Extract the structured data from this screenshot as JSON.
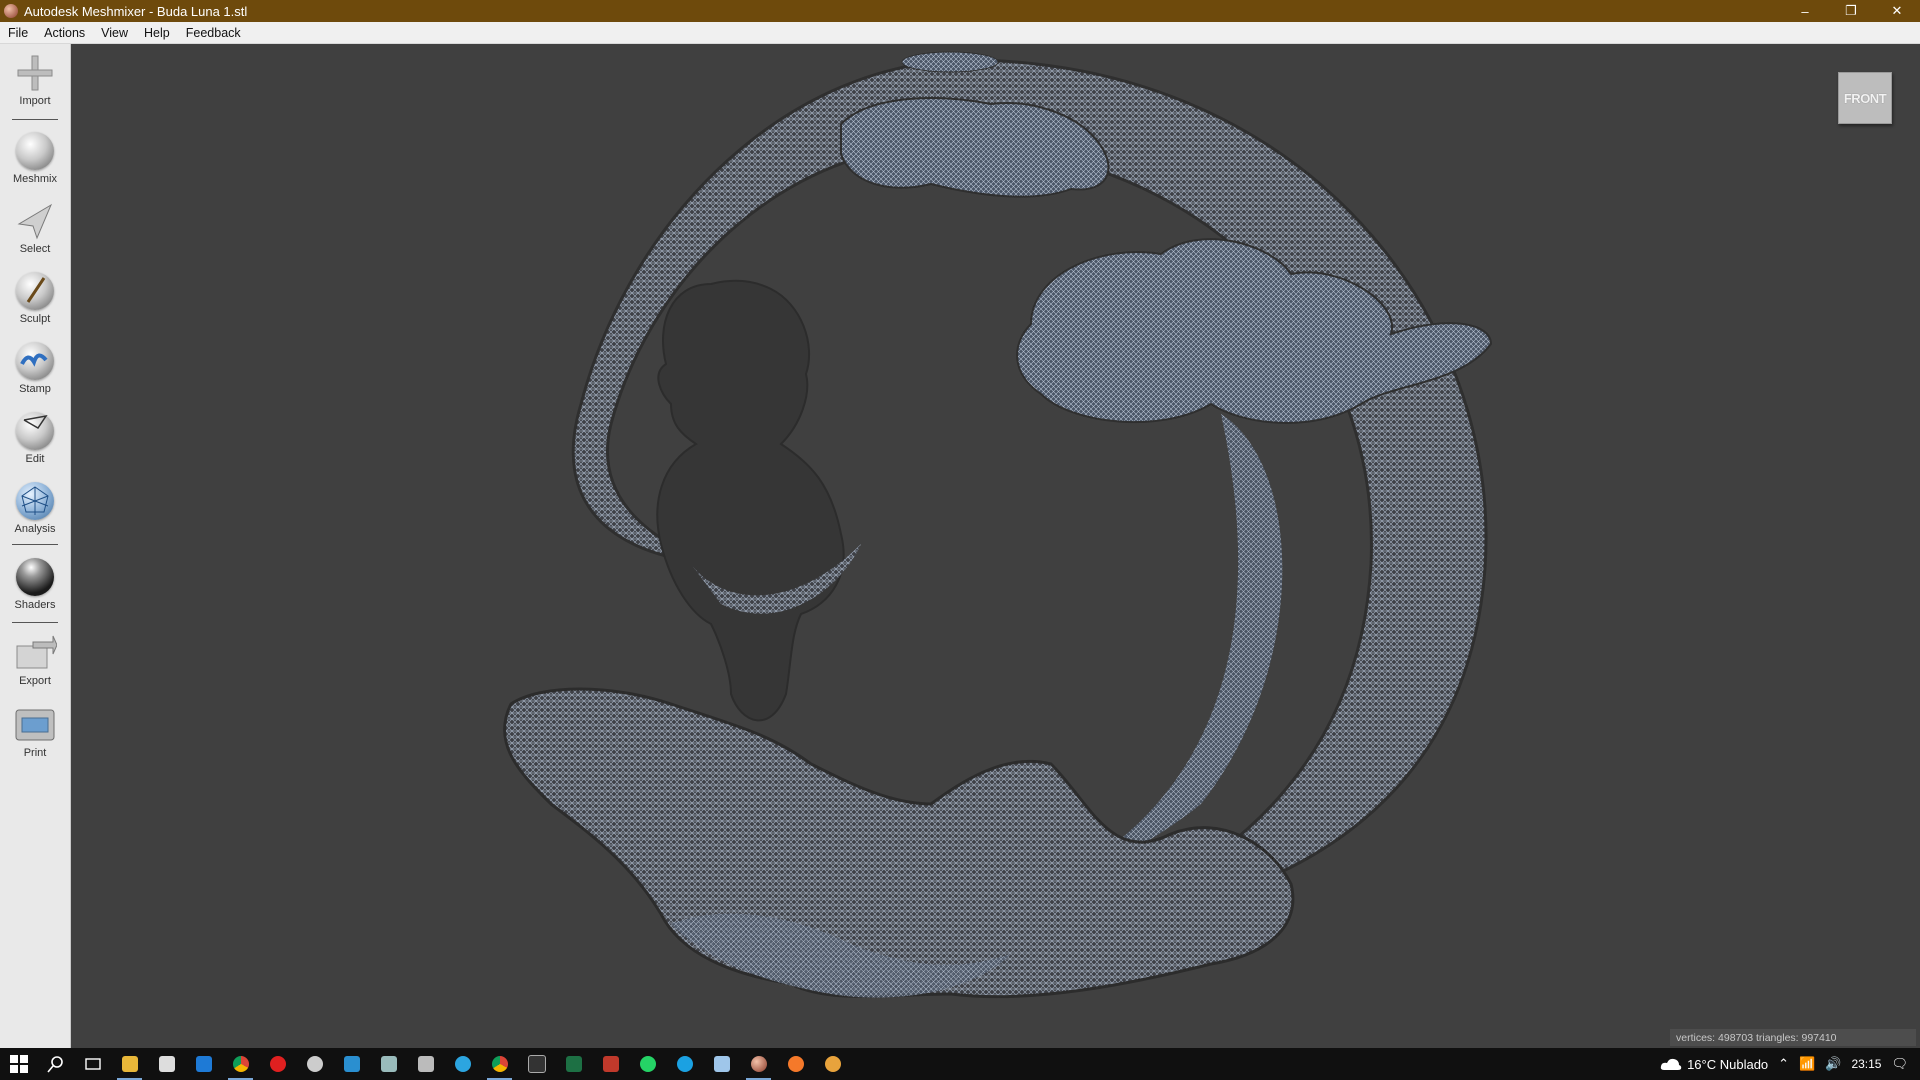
{
  "window": {
    "title": "Autodesk Meshmixer - Buda Luna 1.stl",
    "controls": {
      "minimize": "–",
      "restore": "❐",
      "close": "✕"
    }
  },
  "menu": [
    "File",
    "Actions",
    "View",
    "Help",
    "Feedback"
  ],
  "tools": [
    {
      "label": "Import",
      "icon": "import-icon"
    },
    {
      "label": "Meshmix",
      "icon": "meshmix-icon"
    },
    {
      "label": "Select",
      "icon": "select-icon"
    },
    {
      "label": "Sculpt",
      "icon": "sculpt-icon"
    },
    {
      "label": "Stamp",
      "icon": "stamp-icon"
    },
    {
      "label": "Edit",
      "icon": "edit-icon"
    },
    {
      "label": "Analysis",
      "icon": "analysis-icon"
    },
    {
      "label": "Shaders",
      "icon": "shaders-icon"
    },
    {
      "label": "Export",
      "icon": "export-icon"
    },
    {
      "label": "Print",
      "icon": "print-icon"
    }
  ],
  "viewport": {
    "view_cube_label": "FRONT",
    "stats": "vertices: 498703 triangles: 997410"
  },
  "taskbar": {
    "apps": [
      "start-icon",
      "search-icon",
      "task-view-icon",
      "file-explorer-icon",
      "store-icon",
      "mail-icon",
      "chrome-icon",
      "media-icon",
      "app-icon",
      "app-icon",
      "app-icon",
      "app-icon",
      "telegram-icon",
      "chrome-icon",
      "terminal-icon",
      "excel-icon",
      "app-icon",
      "whatsapp-icon",
      "app-icon",
      "notes-icon",
      "meshmixer-icon",
      "blender-icon",
      "app-icon"
    ],
    "weather": "16°C  Nublado",
    "time": "23:15"
  },
  "colors": {
    "titlebar": "#6e4a0c",
    "viewport": "#404040",
    "mesh": "#8a96a8"
  }
}
